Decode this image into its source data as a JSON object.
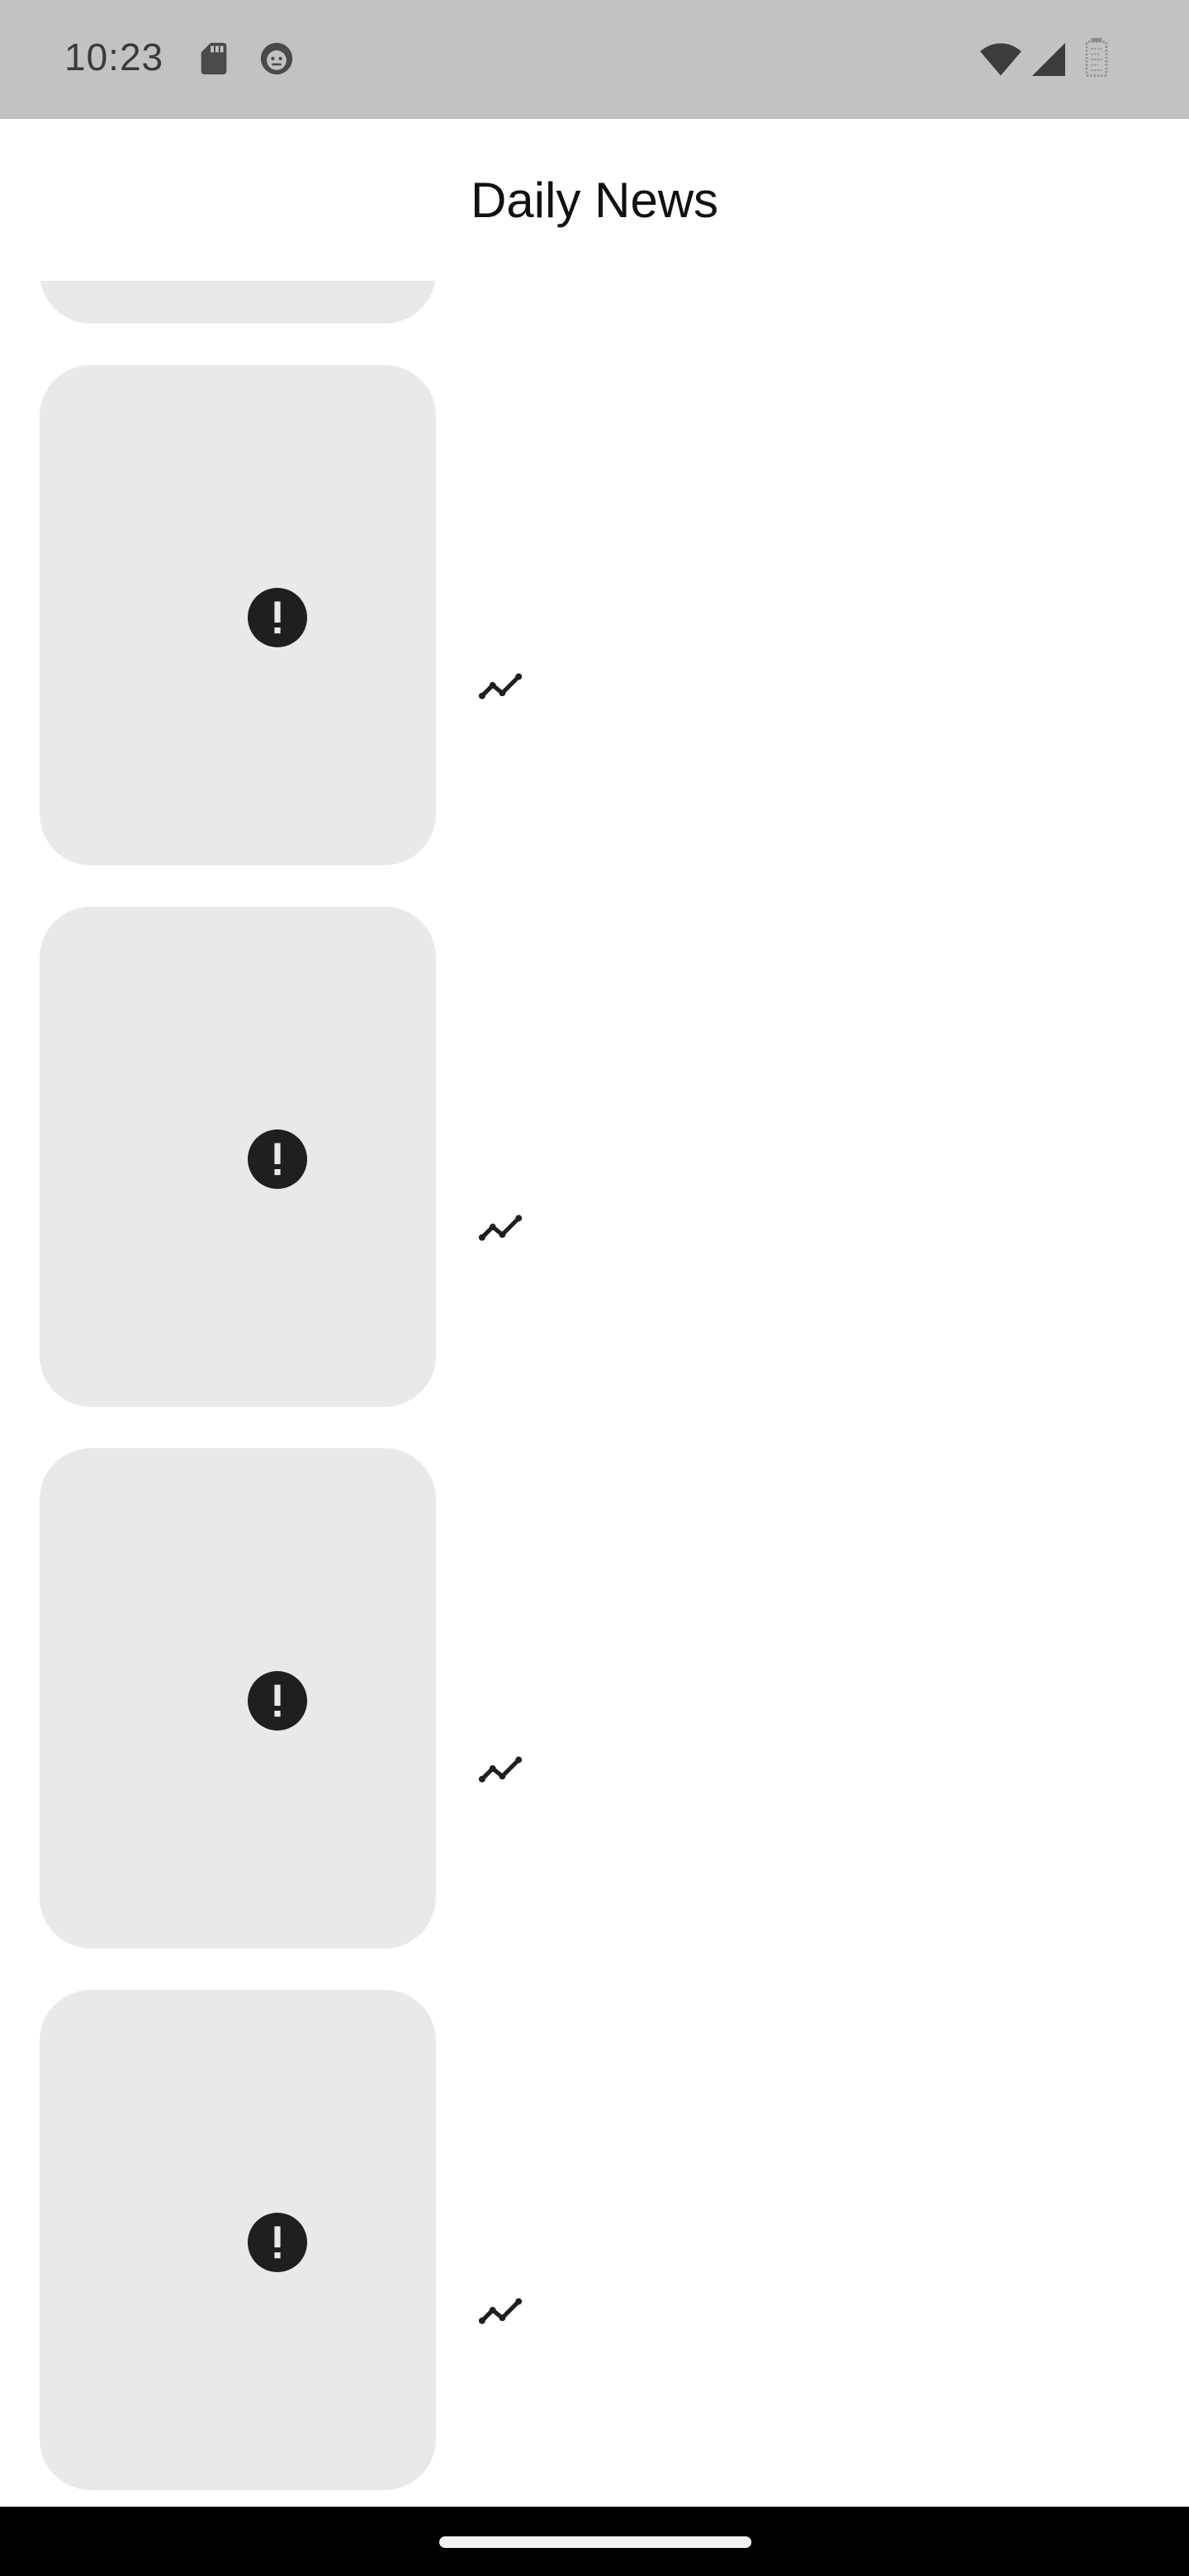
{
  "status_bar": {
    "time": "10:23",
    "left_icons": [
      "sd-card-icon",
      "android-debug-icon"
    ],
    "right_icons": [
      "wifi-icon",
      "signal-icon",
      "battery-icon"
    ],
    "background": "#c2c2c2"
  },
  "app_bar": {
    "title": "Daily News"
  },
  "news_list": {
    "items": [
      {
        "thumbnail_icon": "error-icon",
        "trend_icon": "trending-icon"
      },
      {
        "thumbnail_icon": "error-icon",
        "trend_icon": "trending-icon"
      },
      {
        "thumbnail_icon": "error-icon",
        "trend_icon": "trending-icon"
      },
      {
        "thumbnail_icon": "error-icon",
        "trend_icon": "trending-icon"
      }
    ]
  },
  "colors": {
    "card_background": "#e9e9e9",
    "icon": "#1f1f1f",
    "nav_bar": "#000000"
  }
}
